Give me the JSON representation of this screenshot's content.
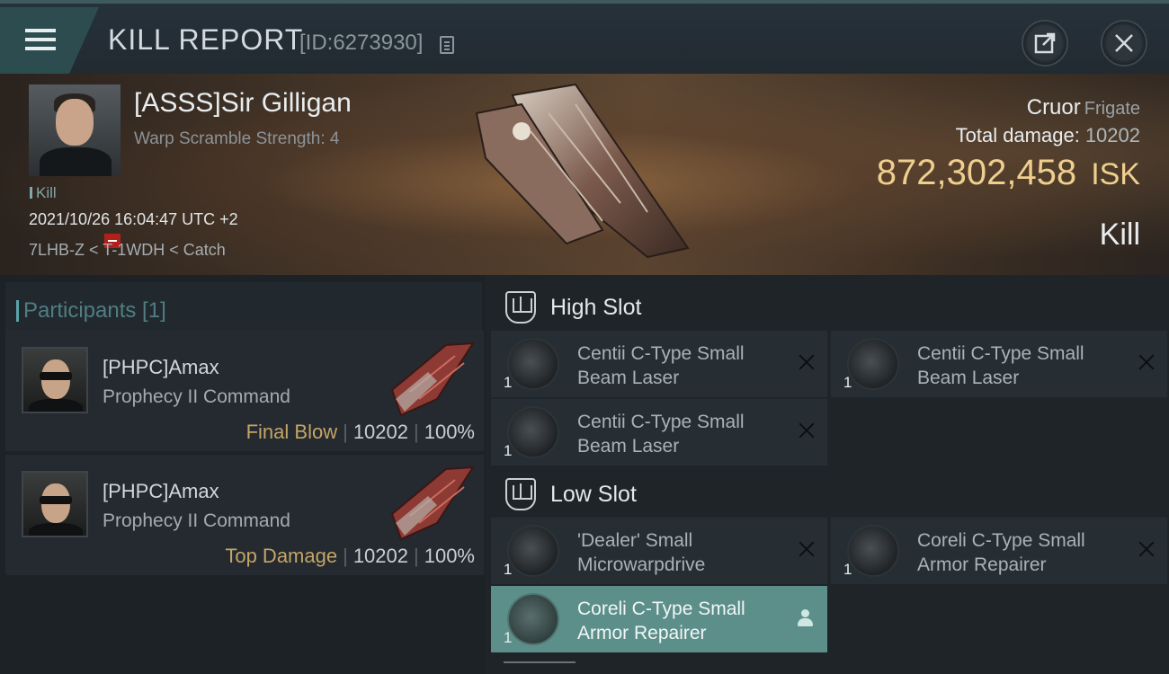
{
  "header": {
    "title": "KILL REPORT",
    "report_id": "[ID:6273930]"
  },
  "victim": {
    "name": "[ASSS]Sir Gilligan",
    "scramble": "Warp Scramble Strength: 4",
    "tag": "Kill",
    "datetime": "2021/10/26 16:04:47 UTC +2",
    "location": "7LHB-Z < T-1WDH < Catch",
    "ship": "Cruor",
    "ship_class": "Frigate",
    "total_damage_label": "Total damage:",
    "total_damage": "10202",
    "isk_value": "872,302,458",
    "isk_unit": "ISK",
    "result": "Kill"
  },
  "participants": {
    "title": "Participants [1]",
    "entries": [
      {
        "name": "[PHPC]Amax",
        "ship": "Prophecy II Command",
        "role": "Final Blow",
        "damage": "10202",
        "percent": "100%"
      },
      {
        "name": "[PHPC]Amax",
        "ship": "Prophecy II Command",
        "role": "Top Damage",
        "damage": "10202",
        "percent": "100%"
      }
    ],
    "separator": "|"
  },
  "fittings": {
    "high_slot": {
      "title": "High Slot",
      "items": [
        {
          "qty": "1",
          "name": "Centii C-Type Small Beam Laser"
        },
        {
          "qty": "1",
          "name": "Centii C-Type Small Beam Laser"
        },
        {
          "qty": "1",
          "name": "Centii C-Type Small Beam Laser"
        }
      ]
    },
    "low_slot": {
      "title": "Low Slot",
      "items": [
        {
          "qty": "1",
          "name": "'Dealer' Small Microwarpdrive"
        },
        {
          "qty": "1",
          "name": "Coreli C-Type Small Armor Repairer"
        },
        {
          "qty": "1",
          "name": "Coreli C-Type Small Armor Repairer"
        }
      ]
    }
  },
  "colors": {
    "accent": "#5c8f8a",
    "isk": "#efcf8e",
    "role": "#c5a566",
    "loss_badge": "#b2201c"
  },
  "icons": [
    "menu-icon",
    "copy-icon",
    "share-icon",
    "close-icon",
    "slot-icon",
    "remove-icon",
    "person-icon"
  ]
}
